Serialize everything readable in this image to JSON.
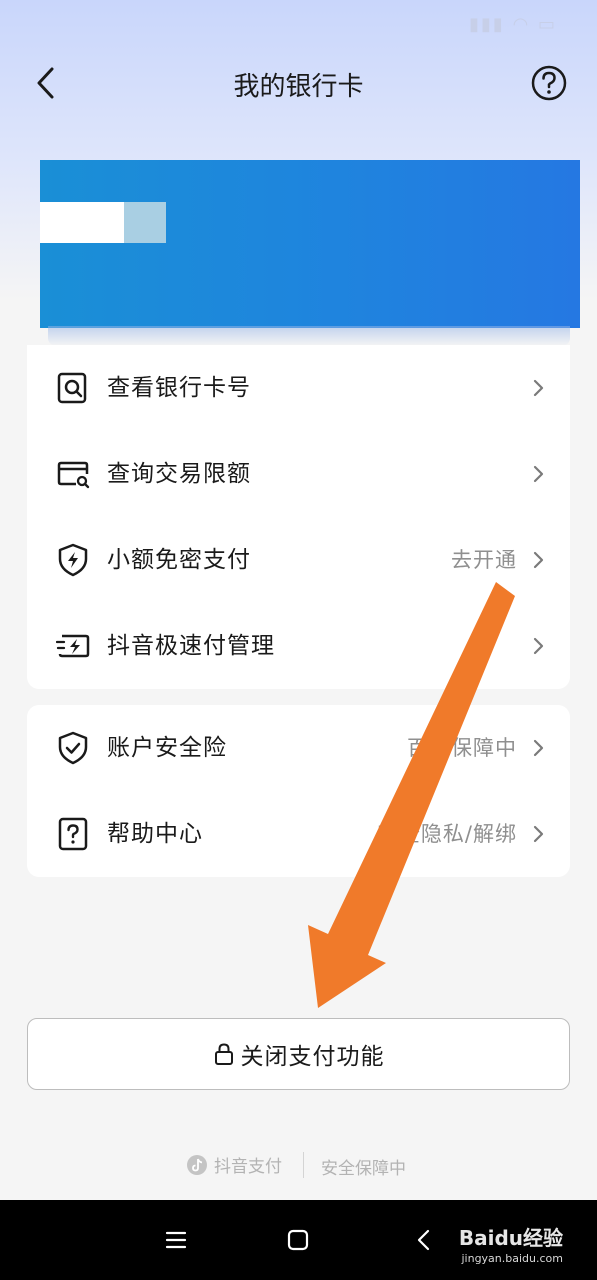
{
  "header": {
    "title": "我的银行卡"
  },
  "menu_group_1": [
    {
      "label": "查看银行卡号",
      "value": "",
      "icon": "card-search-icon"
    },
    {
      "label": "查询交易限额",
      "value": "",
      "icon": "card-query-icon"
    },
    {
      "label": "小额免密支付",
      "value": "去开通",
      "icon": "shield-lightning-icon"
    },
    {
      "label": "抖音极速付管理",
      "value": "",
      "icon": "fast-pay-icon"
    }
  ],
  "menu_group_2": [
    {
      "label": "账户安全险",
      "value": "百万保障中",
      "icon": "shield-check-icon"
    },
    {
      "label": "帮助中心",
      "value": "安全隐私/解绑",
      "icon": "help-doc-icon"
    }
  ],
  "actions": {
    "close_payment": "关闭支付功能"
  },
  "footer": {
    "brand": "抖音支付",
    "note": "安全保障中"
  },
  "watermark": {
    "main": "Baidu经验",
    "sub": "jingyan.baidu.com"
  },
  "colors": {
    "card_start": "#1a8fd6",
    "card_end": "#2578e2",
    "annotation_arrow": "#f07a2a"
  }
}
